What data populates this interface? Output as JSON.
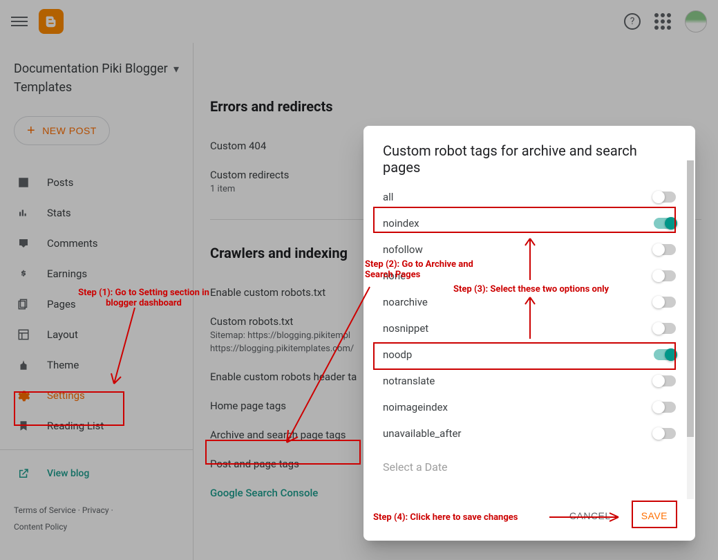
{
  "header": {},
  "blogSelector": {
    "name": "Documentation Piki Blogger Templates"
  },
  "newPostLabel": "NEW POST",
  "nav": {
    "posts": "Posts",
    "stats": "Stats",
    "comments": "Comments",
    "earnings": "Earnings",
    "pages": "Pages",
    "layout": "Layout",
    "theme": "Theme",
    "settings": "Settings",
    "readingList": "Reading List",
    "viewBlog": "View blog"
  },
  "footer": {
    "tos": "Terms of Service",
    "privacy": "Privacy",
    "contentPolicy": "Content Policy"
  },
  "sections": {
    "errorsRedirects": {
      "title": "Errors and redirects",
      "custom404": "Custom 404",
      "customRedirects": "Custom redirects",
      "itemCount": "1 item"
    },
    "crawlers": {
      "title": "Crawlers and indexing",
      "enableRobotsTxt": "Enable custom robots.txt",
      "customRobotsTxt": "Custom robots.txt",
      "sitemap1": "Sitemap: https://blogging.pikitempl",
      "sitemap2": "https://blogging.pikitemplates.com/",
      "enableRobotsHeader": "Enable custom robots header ta",
      "homePageTags": "Home page tags",
      "archiveSearchTags": "Archive and search page tags",
      "postPageTags": "Post and page tags",
      "gsc": "Google Search Console"
    }
  },
  "dialog": {
    "title": "Custom robot tags for archive and search pages",
    "options": {
      "all": "all",
      "noindex": "noindex",
      "nofollow": "nofollow",
      "none": "none",
      "noarchive": "noarchive",
      "nosnippet": "nosnippet",
      "noodp": "noodp",
      "notranslate": "notranslate",
      "noimageindex": "noimageindex",
      "unavailable_after": "unavailable_after"
    },
    "selectDate": "Select a Date",
    "cancel": "CANCEL",
    "save": "SAVE"
  },
  "annotations": {
    "step1": "Step (1): Go to Setting section in blogger dashboard",
    "step2": "Step (2): Go to Archive and Search Pages",
    "step3": "Step (3): Select these two options only",
    "step4": "Step (4): Click here to save changes"
  }
}
